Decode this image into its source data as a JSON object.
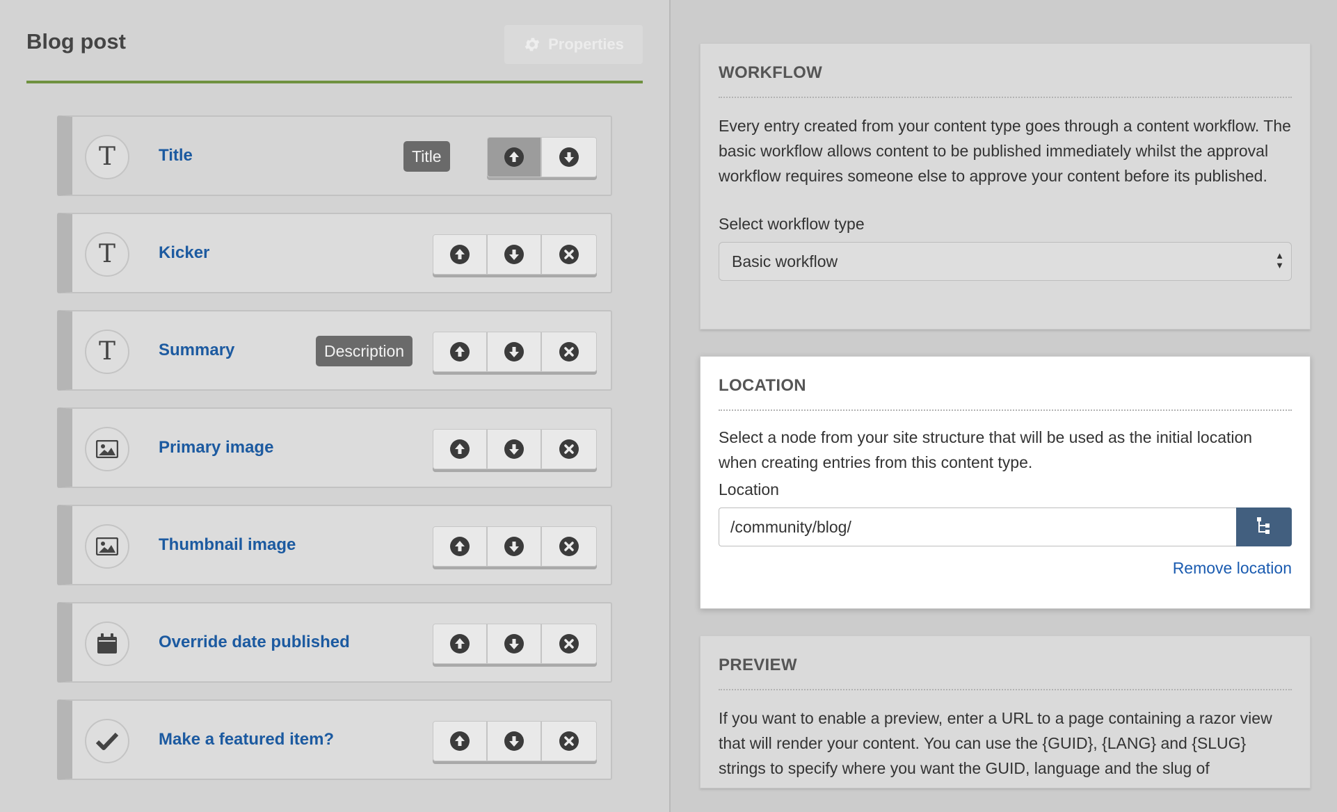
{
  "page": {
    "title": "Blog post",
    "properties_label": "Properties"
  },
  "fields": [
    {
      "label": "Title",
      "icon": "text-type-icon",
      "glyph": "T",
      "tag": "Title",
      "buttons": [
        "move-up",
        "move-down"
      ],
      "active": true
    },
    {
      "label": "Kicker",
      "icon": "text-type-icon",
      "glyph": "T",
      "tag": "",
      "buttons": [
        "move-up",
        "move-down",
        "remove"
      ]
    },
    {
      "label": "Summary",
      "icon": "text-type-icon",
      "glyph": "T",
      "tag": "Description",
      "buttons": [
        "move-up",
        "move-down",
        "remove"
      ]
    },
    {
      "label": "Primary image",
      "icon": "image-icon",
      "glyph": "",
      "tag": "",
      "buttons": [
        "move-up",
        "move-down",
        "remove"
      ]
    },
    {
      "label": "Thumbnail image",
      "icon": "image-icon",
      "glyph": "",
      "tag": "",
      "buttons": [
        "move-up",
        "move-down",
        "remove"
      ]
    },
    {
      "label": "Override date published",
      "icon": "calendar-icon",
      "glyph": "",
      "tag": "",
      "buttons": [
        "move-up",
        "move-down",
        "remove"
      ]
    },
    {
      "label": "Make a featured item?",
      "icon": "checkmark-icon",
      "glyph": "",
      "tag": "",
      "buttons": [
        "move-up",
        "move-down",
        "remove"
      ]
    }
  ],
  "workflow": {
    "heading": "WORKFLOW",
    "description": "Every entry created from your content type goes through a content workflow. The basic workflow allows content to be published immediately whilst the approval workflow requires someone else to approve your content before its published.",
    "select_label": "Select workflow type",
    "selected_value": "Basic workflow"
  },
  "location": {
    "heading": "LOCATION",
    "description": "Select a node from your site structure that will be used as the initial location when creating entries from this content type.",
    "field_label": "Location",
    "value": "/community/blog/",
    "remove_label": "Remove location"
  },
  "preview": {
    "heading": "PREVIEW",
    "description": "If you want to enable a preview, enter a URL to a page containing a razor view that will render your content. You can use the {GUID}, {LANG} and {SLUG} strings to specify where you want the GUID, language and the slug of"
  },
  "colors": {
    "accent_green": "#6f9140",
    "link_blue": "#1c5aa0",
    "tree_button": "#425f7f"
  }
}
